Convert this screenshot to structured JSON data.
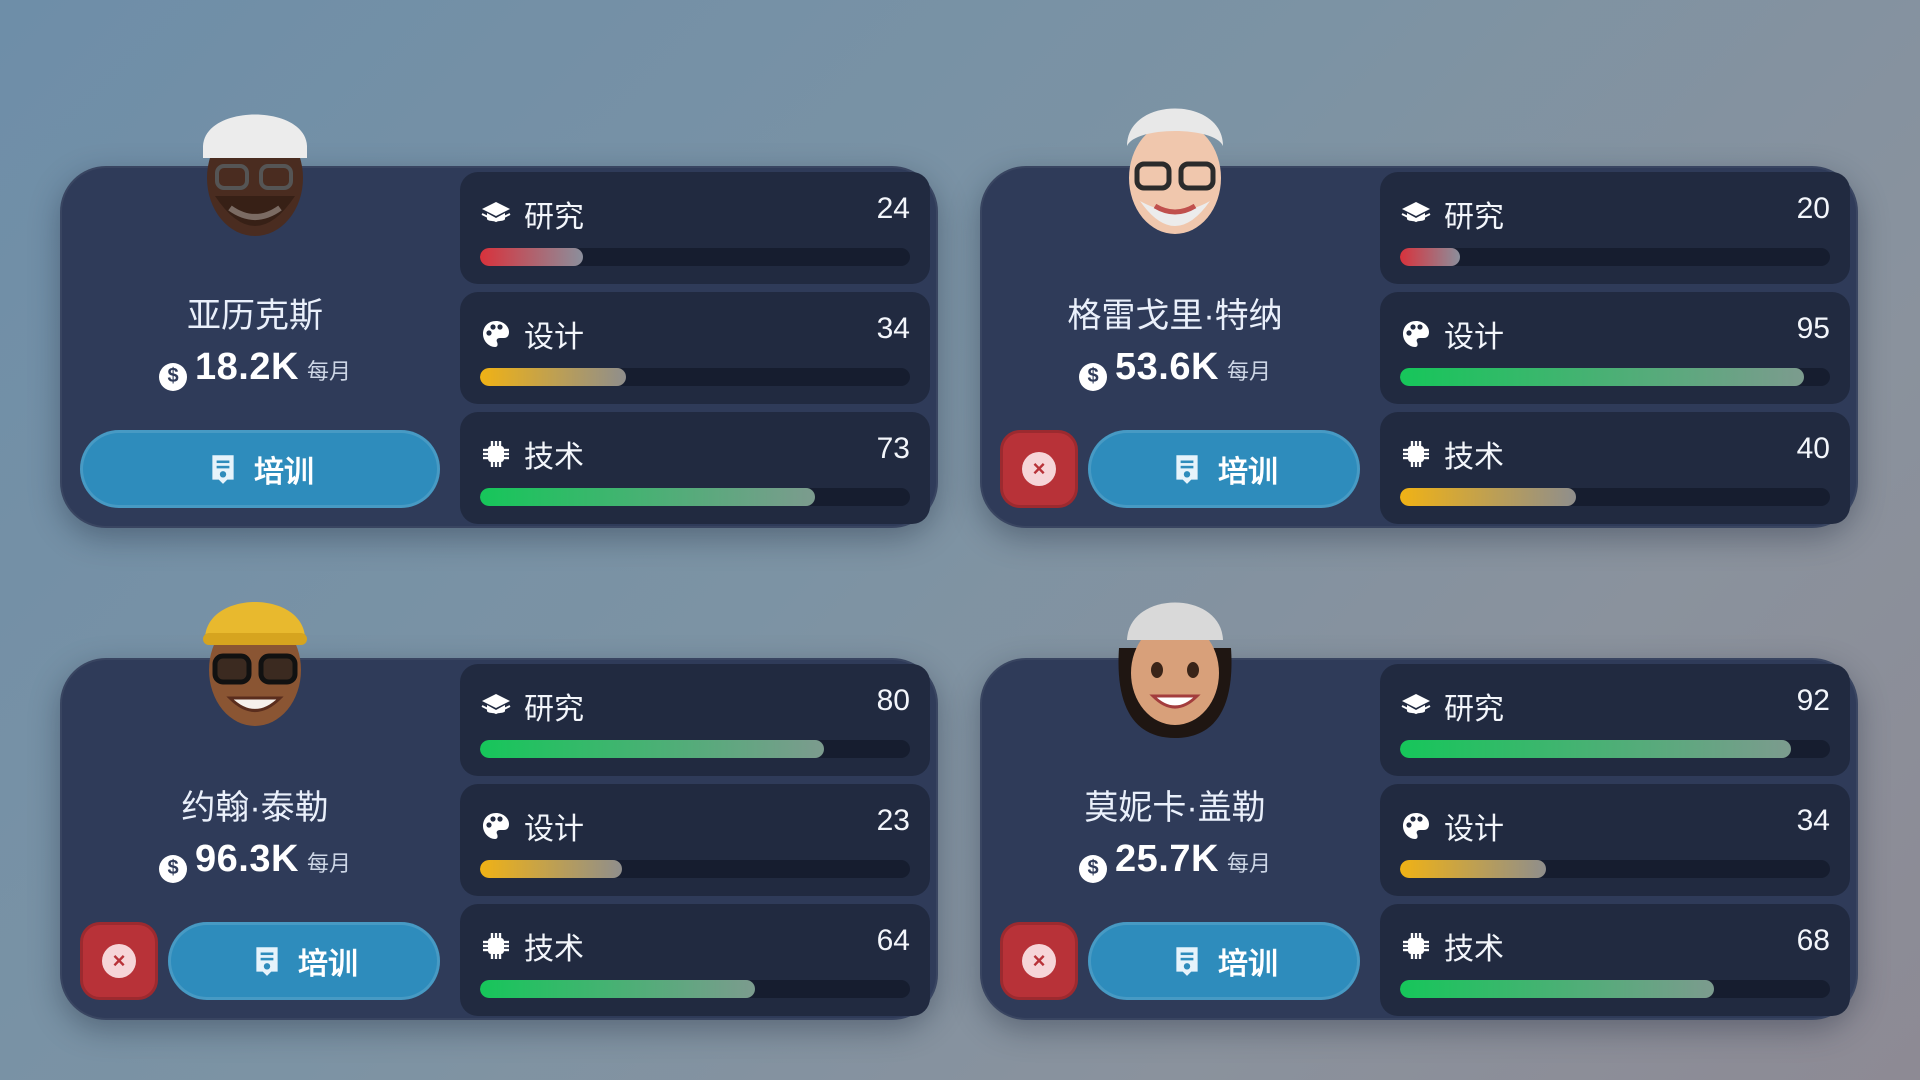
{
  "labels": {
    "research": "研究",
    "design": "设计",
    "tech": "技术",
    "per_month": "每月",
    "train": "培训",
    "currency_symbol": "$",
    "remove_symbol": "×"
  },
  "colors": {
    "red": "#d8323c",
    "yellow": "#f0b215",
    "green": "#16c65a",
    "card": "#2f3b59",
    "button": "#2e8cbc"
  },
  "cards": [
    {
      "name": "亚历克斯",
      "amount": "18.2K",
      "removable": false,
      "stats": {
        "research": {
          "value": "24",
          "percent": 24
        },
        "design": {
          "value": "34",
          "percent": 34
        },
        "tech": {
          "value": "73",
          "percent": 73
        }
      }
    },
    {
      "name": "格雷戈里·特纳",
      "amount": "53.6K",
      "removable": true,
      "stats": {
        "research": {
          "value": "20",
          "percent": 20
        },
        "design": {
          "value": "95",
          "percent": 95
        },
        "tech": {
          "value": "40",
          "percent": 40
        }
      }
    },
    {
      "name": "约翰·泰勒",
      "amount": "96.3K",
      "removable": true,
      "stats": {
        "research": {
          "value": "80",
          "percent": 80
        },
        "design": {
          "value": "23",
          "percent": 23
        },
        "tech": {
          "value": "64",
          "percent": 64
        }
      }
    },
    {
      "name": "莫妮卡·盖勒",
      "amount": "25.7K",
      "removable": true,
      "stats": {
        "research": {
          "value": "92",
          "percent": 92
        },
        "design": {
          "value": "34",
          "percent": 34
        },
        "tech": {
          "value": "68",
          "percent": 68
        }
      }
    }
  ]
}
